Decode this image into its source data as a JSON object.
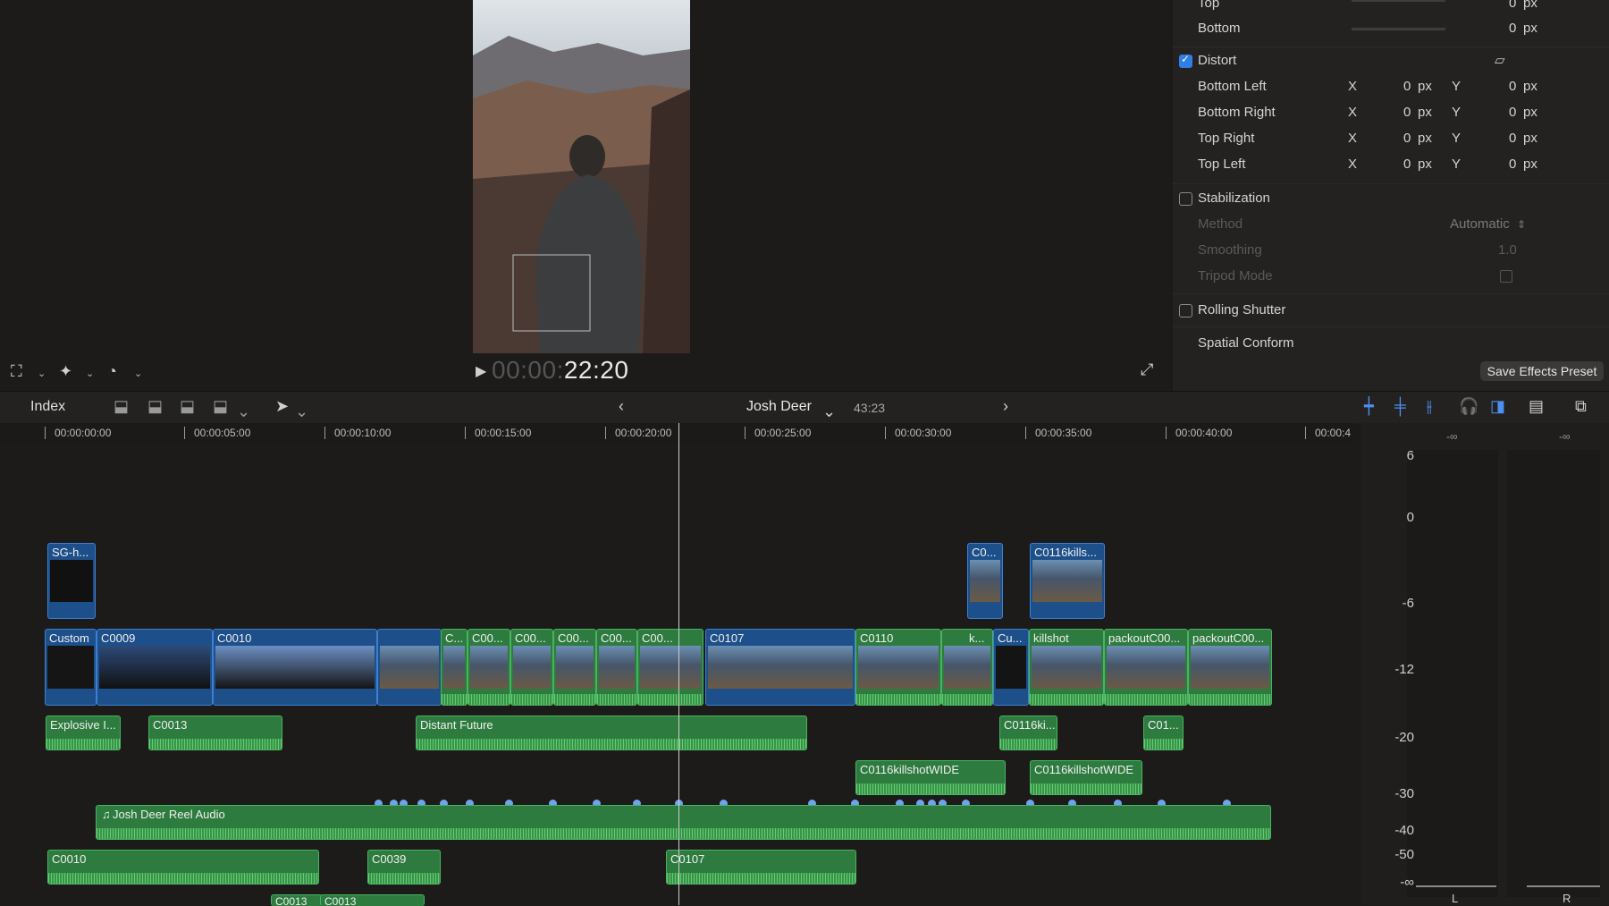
{
  "inspector": {
    "crop_rows": [
      {
        "label": "Top",
        "value": "0",
        "unit": "px"
      },
      {
        "label": "Bottom",
        "value": "0",
        "unit": "px"
      }
    ],
    "distort": {
      "label": "Distort",
      "checked": true,
      "rows": [
        {
          "label": "Bottom Left",
          "x": "0",
          "y": "0"
        },
        {
          "label": "Bottom Right",
          "x": "0",
          "y": "0"
        },
        {
          "label": "Top Right",
          "x": "0",
          "y": "0"
        },
        {
          "label": "Top Left",
          "x": "0",
          "y": "0"
        }
      ],
      "x_label": "X",
      "y_label": "Y",
      "unit": "px"
    },
    "stabilization": {
      "label": "Stabilization",
      "checked": false,
      "method_label": "Method",
      "method_value": "Automatic",
      "smoothing_label": "Smoothing",
      "smoothing_value": "1.0",
      "tripod_label": "Tripod Mode"
    },
    "rolling_shutter": {
      "label": "Rolling Shutter",
      "checked": false
    },
    "spatial_conform": {
      "label": "Spatial Conform"
    },
    "save_effects_preset": "Save Effects Preset"
  },
  "viewer": {
    "timecode_dim": "00:00:",
    "timecode": "22:20"
  },
  "timeline": {
    "index_label": "Index",
    "project_name": "Josh Deer",
    "duration": "43:23",
    "ruler": [
      "00:00:00:00",
      "00:00:05:00",
      "00:00:10:00",
      "00:00:15:00",
      "00:00:20:00",
      "00:00:25:00",
      "00:00:30:00",
      "00:00:35:00",
      "00:00:40:00",
      "00:00:4"
    ],
    "connected_video": [
      "SG-h...",
      "C0...",
      "C0116kills..."
    ],
    "primary": [
      "Custom",
      "C0009",
      "C0010",
      "C...",
      "C00...",
      "C00...",
      "C00...",
      "C00...",
      "C00...",
      "C0107",
      "C0110",
      "k...",
      "Cu...",
      "killshot",
      "packoutC00...",
      "packoutC00..."
    ],
    "audio_row1": [
      "Explosive I...",
      "C0013",
      "Distant Future",
      "C0116ki...",
      "C01..."
    ],
    "audio_row2": [
      "C0116killshotWIDE",
      "C0116killshotWIDE"
    ],
    "music": "Josh Deer Reel Audio",
    "audio_row3": [
      "C0010",
      "C0039",
      "C0107"
    ],
    "audio_row4": [
      "C0013",
      "C0013"
    ]
  },
  "meters": {
    "top_left": "-∞",
    "top_right": "-∞",
    "scale": [
      "6",
      "0",
      "-6",
      "-12",
      "-20",
      "-30",
      "-40",
      "-50",
      "-∞"
    ],
    "channel_left": "L",
    "channel_right": "R"
  }
}
